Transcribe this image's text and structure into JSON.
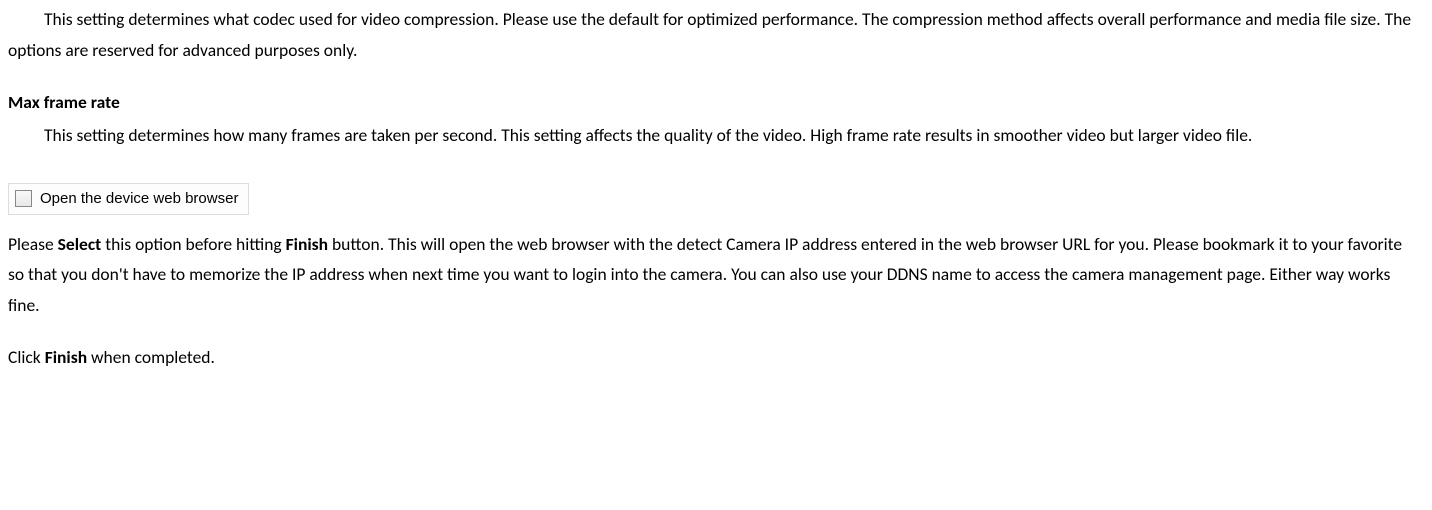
{
  "codec_paragraph": "This setting determines what codec used for video compression. Please use the default for optimized performance. The compression method affects overall performance and media file size. The options are reserved for advanced purposes only.",
  "framerate_heading": "Max frame rate",
  "framerate_paragraph": "This setting determines how many frames are taken per second. This setting affects the quality of the video. High frame rate results in smoother video but larger video file.",
  "checkbox": {
    "label": "Open the device web browser",
    "checked": false
  },
  "select_paragraph": {
    "t1": "Please ",
    "b1": "Select",
    "t2": " this option before hitting ",
    "b2": "Finish",
    "t3": " button. This will open the web browser with the detect Camera IP address entered in the web browser URL for you. Please bookmark it to your favorite so that you don't have to memorize the IP address when next time you want to login into the camera. You can also use your DDNS name to access the camera management page. Either way works fine."
  },
  "finish_paragraph": {
    "t1": "Click ",
    "b1": "Finish",
    "t2": " when completed."
  }
}
